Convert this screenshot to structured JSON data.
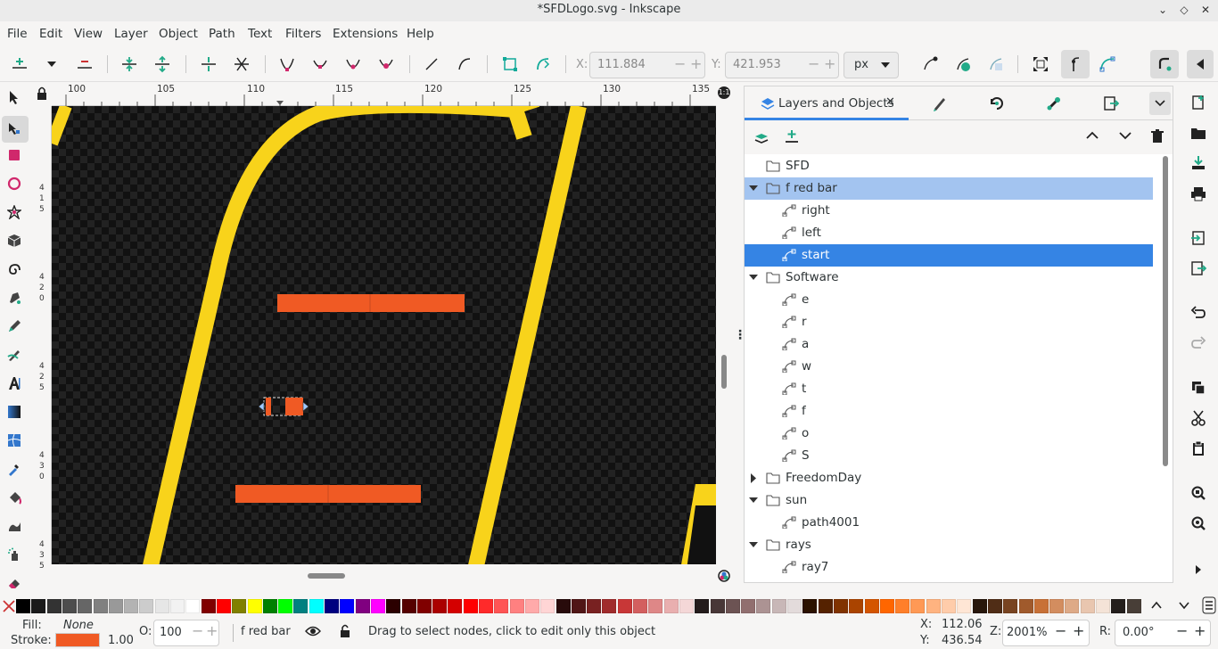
{
  "window": {
    "title": "*SFDLogo.svg - Inkscape",
    "controls": [
      "minimize-icon",
      "maximize-icon",
      "close-icon"
    ]
  },
  "menu": [
    "File",
    "Edit",
    "View",
    "Layer",
    "Object",
    "Path",
    "Text",
    "Filters",
    "Extensions",
    "Help"
  ],
  "toolbar": {
    "x_label": "X:",
    "x_value": "111.884",
    "y_label": "Y:",
    "y_value": "421.953",
    "unit": "px",
    "spin_minus": "−",
    "spin_plus": "+"
  },
  "ruler": {
    "top": [
      "100",
      "105",
      "110",
      "115",
      "120",
      "125",
      "130",
      "135"
    ],
    "left": [
      "4\n1\n5",
      "4\n2\n0",
      "4\n2\n5",
      "4\n3\n0",
      "4\n3\n5"
    ]
  },
  "panel": {
    "active_tab": "Layers and Objects",
    "tab_icons": [
      "layers-icon",
      "fill-stroke-icon",
      "transform-icon",
      "preferences-icon",
      "export-icon"
    ]
  },
  "tree": [
    {
      "label": "SFD",
      "kind": "layer",
      "depth": 0,
      "expander": "none",
      "state": ""
    },
    {
      "label": "f red bar",
      "kind": "layer",
      "depth": 0,
      "expander": "open",
      "state": "current"
    },
    {
      "label": "right",
      "kind": "path",
      "depth": 1,
      "expander": "none",
      "state": ""
    },
    {
      "label": "left",
      "kind": "path",
      "depth": 1,
      "expander": "none",
      "state": ""
    },
    {
      "label": "start",
      "kind": "path",
      "depth": 1,
      "expander": "none",
      "state": "selected"
    },
    {
      "label": "Software",
      "kind": "layer",
      "depth": 0,
      "expander": "open",
      "state": ""
    },
    {
      "label": "e",
      "kind": "path",
      "depth": 1,
      "expander": "none",
      "state": ""
    },
    {
      "label": "r",
      "kind": "path",
      "depth": 1,
      "expander": "none",
      "state": ""
    },
    {
      "label": "a",
      "kind": "path",
      "depth": 1,
      "expander": "none",
      "state": ""
    },
    {
      "label": "w",
      "kind": "path",
      "depth": 1,
      "expander": "none",
      "state": ""
    },
    {
      "label": "t",
      "kind": "path",
      "depth": 1,
      "expander": "none",
      "state": ""
    },
    {
      "label": "f",
      "kind": "path",
      "depth": 1,
      "expander": "none",
      "state": ""
    },
    {
      "label": "o",
      "kind": "path",
      "depth": 1,
      "expander": "none",
      "state": ""
    },
    {
      "label": "S",
      "kind": "path",
      "depth": 1,
      "expander": "none",
      "state": ""
    },
    {
      "label": "FreedomDay",
      "kind": "layer",
      "depth": 0,
      "expander": "closed",
      "state": ""
    },
    {
      "label": "sun",
      "kind": "layer",
      "depth": 0,
      "expander": "open",
      "state": ""
    },
    {
      "label": "path4001",
      "kind": "path",
      "depth": 1,
      "expander": "none",
      "state": ""
    },
    {
      "label": "rays",
      "kind": "layer",
      "depth": 0,
      "expander": "open",
      "state": ""
    },
    {
      "label": "ray7",
      "kind": "path",
      "depth": 1,
      "expander": "none",
      "state": ""
    }
  ],
  "palette": [
    "#000000",
    "#1a1a1a",
    "#333333",
    "#4d4d4d",
    "#666666",
    "#808080",
    "#999999",
    "#b3b3b3",
    "#cccccc",
    "#e6e6e6",
    "#f2f2f2",
    "#ffffff",
    "#800000",
    "#ff0000",
    "#808000",
    "#ffff00",
    "#008000",
    "#00ff00",
    "#008080",
    "#00ffff",
    "#000080",
    "#0000ff",
    "#800080",
    "#ff00ff",
    "#2b0000",
    "#550000",
    "#800000",
    "#aa0000",
    "#d40000",
    "#ff0000",
    "#ff2a2a",
    "#ff5555",
    "#ff8080",
    "#ffaaaa",
    "#ffd5d5",
    "#280b0b",
    "#501616",
    "#782121",
    "#a02c2c",
    "#c83737",
    "#d35f5f",
    "#de8787",
    "#e9afaf",
    "#f4d7d7",
    "#241c1c",
    "#483737",
    "#6c5353",
    "#916f6f",
    "#ac9393",
    "#c8b7b7",
    "#e3dbdb",
    "#2b1100",
    "#552200",
    "#803300",
    "#aa4400",
    "#d45500",
    "#ff6600",
    "#ff7f2a",
    "#ff9955",
    "#ffb380",
    "#ffccaa",
    "#ffe6d5",
    "#28170b",
    "#502d16",
    "#784421",
    "#a05a2c",
    "#c87137",
    "#d38d5f",
    "#deaa87",
    "#e9c6af",
    "#f4e3d7",
    "#241f1c",
    "#483e37",
    "#6c5d53",
    "#917c6f",
    "#ac9d93"
  ],
  "colors": {
    "canvas_bg": "#111111",
    "yellow": "#f8d31b",
    "orange": "#f05a24",
    "selection": "#3584e4",
    "current_layer": "#a3c4f0"
  },
  "status": {
    "fill_label": "Fill:",
    "fill_value": "None",
    "stroke_label": "Stroke:",
    "stroke_width": "1.00",
    "opacity_label": "O:",
    "opacity_value": "100",
    "layer_name": "f red bar",
    "message": "Drag to select nodes, click to edit only this object",
    "x_label": "X:",
    "x_value": "112.06",
    "y_label": "Y:",
    "y_value": "436.54",
    "zoom_label": "Z:",
    "zoom_value": "2001%",
    "rotation_label": "R:",
    "rotation_value": "0.00°"
  }
}
